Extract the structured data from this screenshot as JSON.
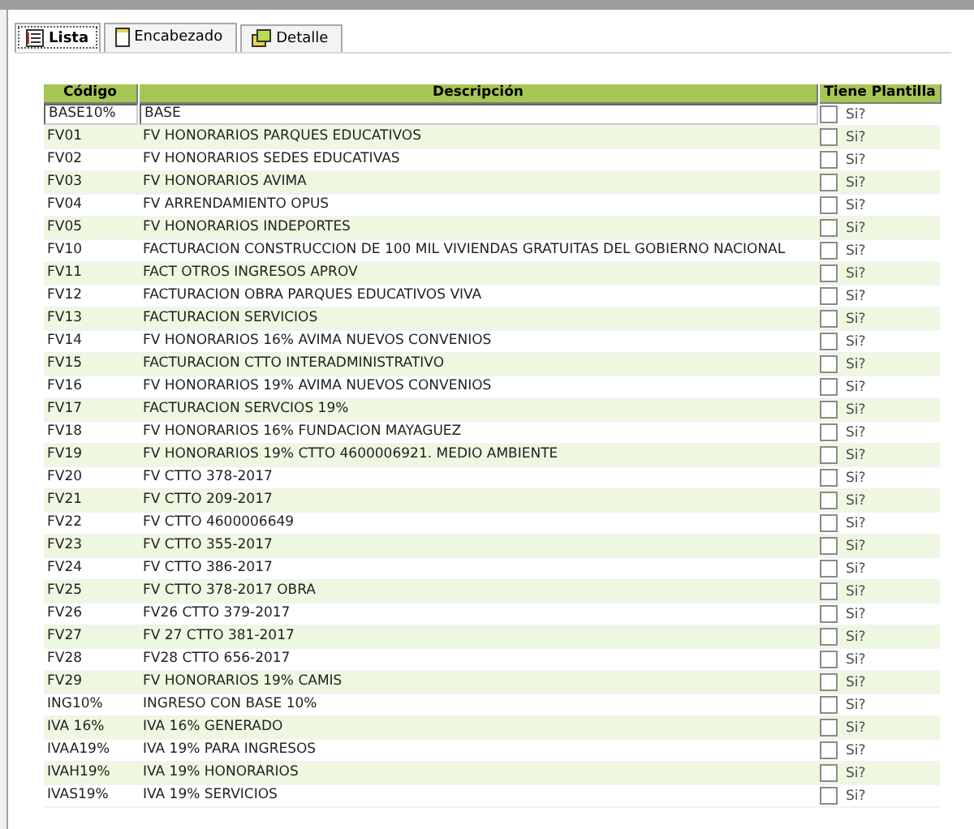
{
  "tabs": [
    {
      "label": "Lista",
      "selected": true
    },
    {
      "label": "Encabezado",
      "selected": false
    },
    {
      "label": "Detalle",
      "selected": false
    }
  ],
  "table": {
    "columns": [
      "Código",
      "Descripción",
      "Tiene Plantilla"
    ],
    "rows": [
      {
        "code": "BASE10%",
        "description": "BASE",
        "template": "Si?",
        "checked": false,
        "selected": true
      },
      {
        "code": "FV01",
        "description": "FV HONORARIOS PARQUES EDUCATIVOS",
        "template": "Si?",
        "checked": false,
        "selected": false
      },
      {
        "code": "FV02",
        "description": "FV HONORARIOS SEDES EDUCATIVAS",
        "template": "Si?",
        "checked": false,
        "selected": false
      },
      {
        "code": "FV03",
        "description": "FV HONORARIOS AVIMA",
        "template": "Si?",
        "checked": false,
        "selected": false
      },
      {
        "code": "FV04",
        "description": "FV ARRENDAMIENTO OPUS",
        "template": "Si?",
        "checked": false,
        "selected": false
      },
      {
        "code": "FV05",
        "description": "FV HONORARIOS INDEPORTES",
        "template": "Si?",
        "checked": false,
        "selected": false
      },
      {
        "code": "FV10",
        "description": "FACTURACION CONSTRUCCION DE 100 MIL VIVIENDAS GRATUITAS DEL GOBIERNO NACIONAL",
        "template": "Si?",
        "checked": false,
        "selected": false
      },
      {
        "code": "FV11",
        "description": "FACT OTROS INGRESOS APROV",
        "template": "Si?",
        "checked": false,
        "selected": false
      },
      {
        "code": "FV12",
        "description": "FACTURACION OBRA PARQUES EDUCATIVOS VIVA",
        "template": "Si?",
        "checked": false,
        "selected": false
      },
      {
        "code": "FV13",
        "description": "FACTURACION SERVICIOS",
        "template": "Si?",
        "checked": false,
        "selected": false
      },
      {
        "code": "FV14",
        "description": "FV HONORARIOS 16% AVIMA NUEVOS CONVENIOS",
        "template": "Si?",
        "checked": false,
        "selected": false
      },
      {
        "code": "FV15",
        "description": "FACTURACION CTTO INTERADMINISTRATIVO",
        "template": "Si?",
        "checked": false,
        "selected": false
      },
      {
        "code": "FV16",
        "description": "FV HONORARIOS 19% AVIMA NUEVOS CONVENIOS",
        "template": "Si?",
        "checked": false,
        "selected": false
      },
      {
        "code": "FV17",
        "description": "FACTURACION SERVCIOS 19%",
        "template": "Si?",
        "checked": false,
        "selected": false
      },
      {
        "code": "FV18",
        "description": "FV HONORARIOS 16%  FUNDACION MAYAGUEZ",
        "template": "Si?",
        "checked": false,
        "selected": false
      },
      {
        "code": "FV19",
        "description": "FV HONORARIOS 19% CTTO 4600006921. MEDIO AMBIENTE",
        "template": "Si?",
        "checked": false,
        "selected": false
      },
      {
        "code": "FV20",
        "description": "FV CTTO 378-2017",
        "template": "Si?",
        "checked": false,
        "selected": false
      },
      {
        "code": "FV21",
        "description": "FV CTTO 209-2017",
        "template": "Si?",
        "checked": false,
        "selected": false
      },
      {
        "code": "FV22",
        "description": "FV CTTO 4600006649",
        "template": "Si?",
        "checked": false,
        "selected": false
      },
      {
        "code": "FV23",
        "description": "FV CTTO 355-2017",
        "template": "Si?",
        "checked": false,
        "selected": false
      },
      {
        "code": "FV24",
        "description": "FV CTTO 386-2017",
        "template": "Si?",
        "checked": false,
        "selected": false
      },
      {
        "code": "FV25",
        "description": "FV CTTO 378-2017 OBRA",
        "template": "Si?",
        "checked": false,
        "selected": false
      },
      {
        "code": "FV26",
        "description": "FV26 CTTO 379-2017",
        "template": "Si?",
        "checked": false,
        "selected": false
      },
      {
        "code": "FV27",
        "description": "FV 27 CTTO 381-2017",
        "template": "Si?",
        "checked": false,
        "selected": false
      },
      {
        "code": "FV28",
        "description": "FV28 CTTO 656-2017",
        "template": "Si?",
        "checked": false,
        "selected": false
      },
      {
        "code": "FV29",
        "description": "FV HONORARIOS 19% CAMIS",
        "template": "Si?",
        "checked": false,
        "selected": false
      },
      {
        "code": "ING10%",
        "description": "INGRESO CON BASE 10%",
        "template": "Si?",
        "checked": false,
        "selected": false
      },
      {
        "code": "IVA 16%",
        "description": "IVA 16% GENERADO",
        "template": "Si?",
        "checked": false,
        "selected": false
      },
      {
        "code": "IVAA19%",
        "description": "IVA 19% PARA INGRESOS",
        "template": "Si?",
        "checked": false,
        "selected": false
      },
      {
        "code": "IVAH19%",
        "description": "IVA 19% HONORARIOS",
        "template": "Si?",
        "checked": false,
        "selected": false
      },
      {
        "code": "IVAS19%",
        "description": "IVA 19% SERVICIOS",
        "template": "Si?",
        "checked": false,
        "selected": false
      }
    ]
  }
}
